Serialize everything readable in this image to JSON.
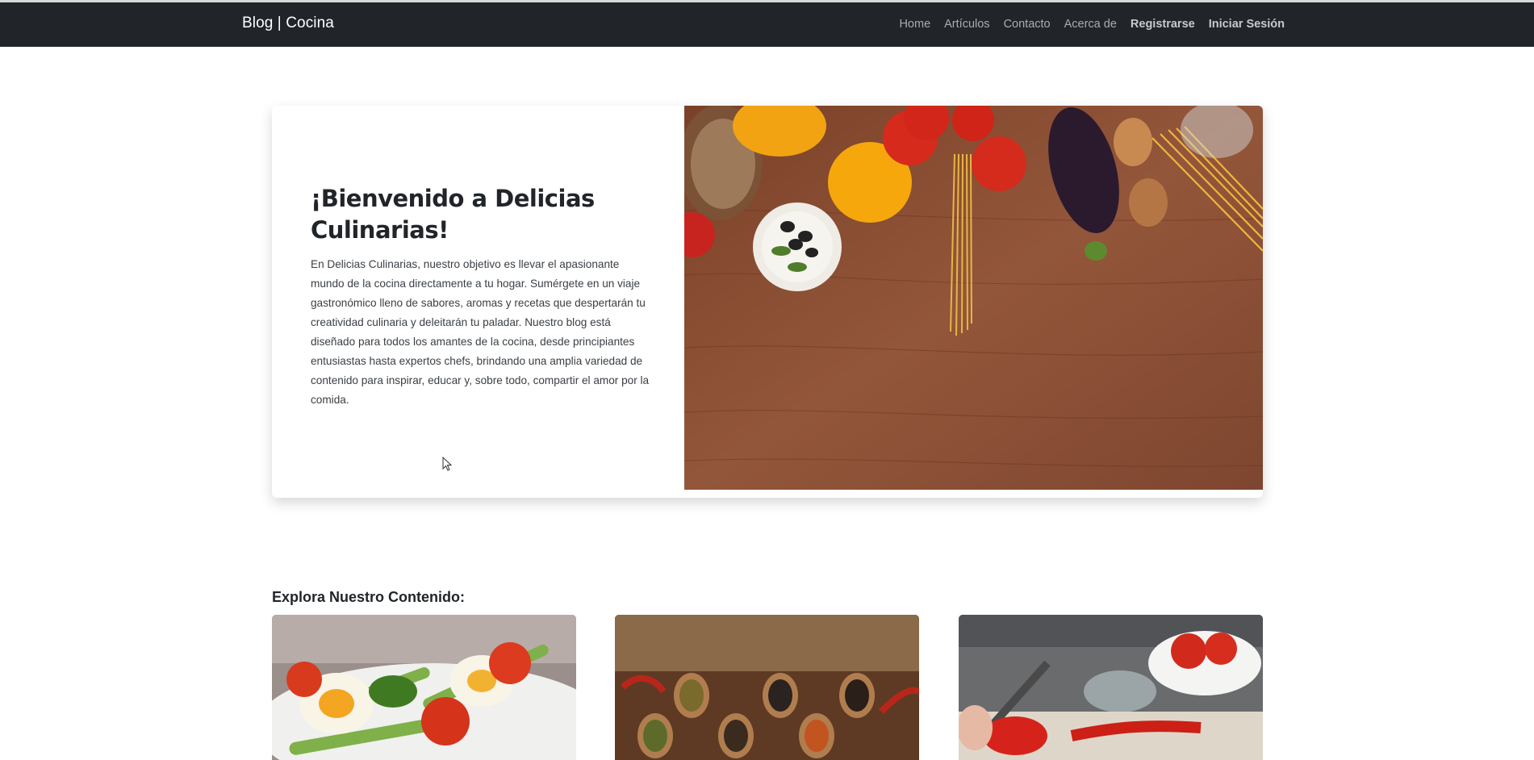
{
  "navbar": {
    "brand": "Blog | Cocina",
    "links": [
      {
        "label": "Home"
      },
      {
        "label": "Artículos"
      },
      {
        "label": "Contacto"
      },
      {
        "label": "Acerca de"
      },
      {
        "label": "Registrarse"
      },
      {
        "label": "Iniciar Sesión"
      }
    ]
  },
  "hero": {
    "title": "¡Bienvenido a Delicias Culinarias!",
    "description": "En Delicias Culinarias, nuestro objetivo es llevar el apasionante mundo de la cocina directamente a tu hogar. Sumérgete en un viaje gastronómico lleno de sabores, aromas y recetas que despertarán tu creatividad culinaria y deleitarán tu paladar. Nuestro blog está diseñado para todos los amantes de la cocina, desde principiantes entusiastas hasta expertos chefs, brindando una amplia variedad de contenido para inspirar, educar y, sobre todo, compartir el amor por la comida."
  },
  "content": {
    "section_title": "Explora Nuestro Contenido:"
  },
  "colors": {
    "navbar_bg": "#212529",
    "nav_link": "#a9adb2",
    "wood": "#8a4f33"
  }
}
